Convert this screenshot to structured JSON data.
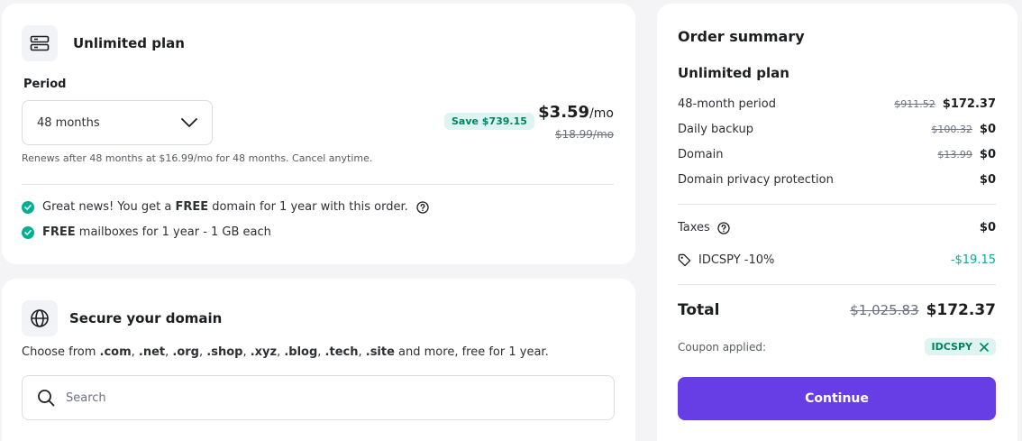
{
  "plan": {
    "title": "Unlimited plan",
    "period_label": "Period",
    "period_value": "48 months",
    "save_badge": "Save $739.15",
    "price": "$3.59",
    "price_unit": "/mo",
    "old_price": "$18.99/mo",
    "renew_note": "Renews after 48 months at $16.99/mo for 48 months. Cancel anytime.",
    "benefit_1_pre": "Great news! You get a ",
    "benefit_1_bold": "FREE",
    "benefit_1_post": " domain for 1 year with this order.",
    "benefit_2_bold": "FREE",
    "benefit_2_post": " mailboxes for 1 year - 1 GB each"
  },
  "domain": {
    "title": "Secure your domain",
    "desc_pre": "Choose from ",
    "tlds": [
      ".com",
      ".net",
      ".org",
      ".shop",
      ".xyz",
      ".blog",
      ".tech",
      ".site"
    ],
    "desc_post": " and more, free for 1 year.",
    "search_placeholder": "Search"
  },
  "summary": {
    "title": "Order summary",
    "plan_name": "Unlimited plan",
    "rows": [
      {
        "label": "48-month period",
        "old": "$911.52",
        "value": "$172.37"
      },
      {
        "label": "Daily backup",
        "old": "$100.32",
        "value": "$0"
      },
      {
        "label": "Domain",
        "old": "$13.99",
        "value": "$0"
      },
      {
        "label": "Domain privacy protection",
        "old": "",
        "value": "$0"
      }
    ],
    "taxes_label": "Taxes",
    "taxes_value": "$0",
    "discount_label": "IDCSPY -10%",
    "discount_value": "-$19.15",
    "total_label": "Total",
    "total_old": "$1,025.83",
    "total_value": "$172.37",
    "coupon_label": "Coupon applied:",
    "coupon_code": "IDCSPY",
    "continue_label": "Continue"
  },
  "colors": {
    "accent": "#673de6",
    "success": "#00b090",
    "badge_bg": "#def4f0",
    "badge_text": "#008361"
  }
}
